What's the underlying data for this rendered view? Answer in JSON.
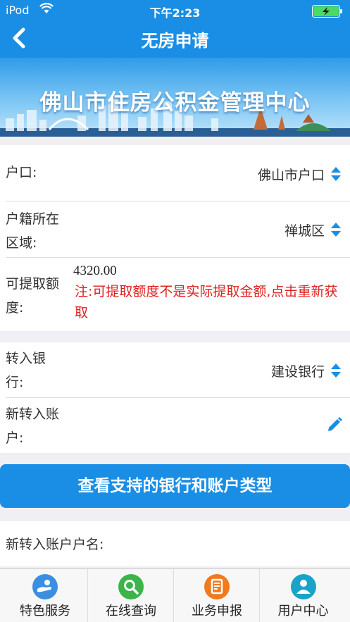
{
  "status_bar": {
    "carrier": "iPod",
    "time": "下午2:23"
  },
  "nav": {
    "title": "无房申请"
  },
  "banner": {
    "text": "佛山市住房公积金管理中心"
  },
  "colors": {
    "primary": "#1a8ee4",
    "warning": "#e02020"
  },
  "form": {
    "hukou_label": "户口:",
    "hukou_value": "佛山市户口",
    "region_label_1": "户籍所在",
    "region_label_2": "区域:",
    "region_value": "禅城区",
    "amount_label_1": "可提取额",
    "amount_label_2": "度:",
    "amount_value": "4320.00",
    "amount_note": "注:可提取额度不是实际提取金额,点击重新获取",
    "bank_label_1": "转入银",
    "bank_label_2": "行:",
    "bank_value": "建设银行",
    "account_label_1": "新转入账",
    "account_label_2": "户:",
    "account_name_label": "新转入账户户名:"
  },
  "buttons": {
    "view_banks": "查看支持的银行和账户类型"
  },
  "tabs": [
    {
      "label": "特色服务",
      "icon": "hand-icon",
      "color": "#3b8fe0"
    },
    {
      "label": "在线查询",
      "icon": "search-icon",
      "color": "#3bb44a"
    },
    {
      "label": "业务申报",
      "icon": "document-icon",
      "color": "#f07a1d"
    },
    {
      "label": "用户中心",
      "icon": "user-icon",
      "color": "#1aa3c9"
    }
  ]
}
